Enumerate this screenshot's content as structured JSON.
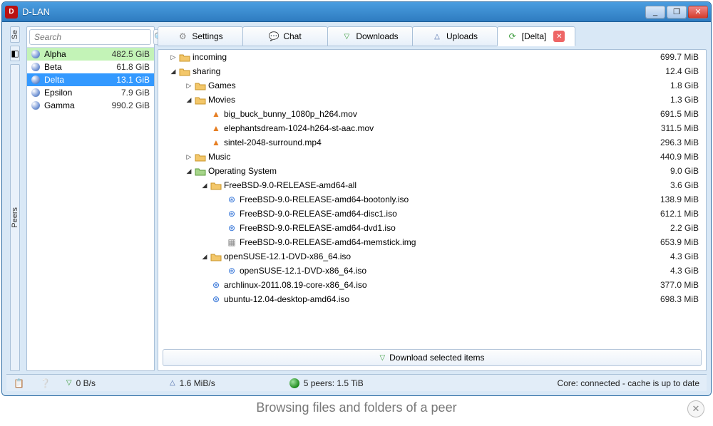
{
  "window": {
    "title": "D-LAN",
    "min": "_",
    "max": "❐",
    "close": "✕"
  },
  "search": {
    "placeholder": "Search"
  },
  "side": {
    "top": "Se",
    "bottom": "Peers"
  },
  "peers": [
    {
      "name": "Alpha",
      "size": "482.5 GiB",
      "cls": "alpha"
    },
    {
      "name": "Beta",
      "size": "61.8 GiB",
      "cls": ""
    },
    {
      "name": "Delta",
      "size": "13.1 GiB",
      "cls": "sel"
    },
    {
      "name": "Epsilon",
      "size": "7.9 GiB",
      "cls": ""
    },
    {
      "name": "Gamma",
      "size": "990.2 GiB",
      "cls": ""
    }
  ],
  "tabs": [
    {
      "label": "Settings",
      "icon": "gear"
    },
    {
      "label": "Chat",
      "icon": "chat"
    },
    {
      "label": "Downloads",
      "icon": "down"
    },
    {
      "label": "Uploads",
      "icon": "up"
    },
    {
      "label": "[Delta]",
      "icon": "refresh",
      "active": true,
      "closable": true
    }
  ],
  "tree": [
    {
      "d": 0,
      "exp": "▷",
      "ico": "folder",
      "name": "incoming",
      "size": "699.7 MiB"
    },
    {
      "d": 0,
      "exp": "◢",
      "ico": "folder",
      "name": "sharing",
      "size": "12.4 GiB"
    },
    {
      "d": 1,
      "exp": "▷",
      "ico": "folder",
      "name": "Games",
      "size": "1.8 GiB"
    },
    {
      "d": 1,
      "exp": "◢",
      "ico": "folder",
      "name": "Movies",
      "size": "1.3 GiB"
    },
    {
      "d": 2,
      "exp": "",
      "ico": "vlc",
      "name": "big_buck_bunny_1080p_h264.mov",
      "size": "691.5 MiB"
    },
    {
      "d": 2,
      "exp": "",
      "ico": "vlc",
      "name": "elephantsdream-1024-h264-st-aac.mov",
      "size": "311.5 MiB"
    },
    {
      "d": 2,
      "exp": "",
      "ico": "vlc",
      "name": "sintel-2048-surround.mp4",
      "size": "296.3 MiB"
    },
    {
      "d": 1,
      "exp": "▷",
      "ico": "folder",
      "name": "Music",
      "size": "440.9 MiB"
    },
    {
      "d": 1,
      "exp": "◢",
      "ico": "folder-green",
      "name": "Operating System",
      "size": "9.0 GiB"
    },
    {
      "d": 2,
      "exp": "◢",
      "ico": "folder",
      "name": "FreeBSD-9.0-RELEASE-amd64-all",
      "size": "3.6 GiB"
    },
    {
      "d": 3,
      "exp": "",
      "ico": "iso",
      "name": "FreeBSD-9.0-RELEASE-amd64-bootonly.iso",
      "size": "138.9 MiB"
    },
    {
      "d": 3,
      "exp": "",
      "ico": "iso",
      "name": "FreeBSD-9.0-RELEASE-amd64-disc1.iso",
      "size": "612.1 MiB"
    },
    {
      "d": 3,
      "exp": "",
      "ico": "iso",
      "name": "FreeBSD-9.0-RELEASE-amd64-dvd1.iso",
      "size": "2.2 GiB"
    },
    {
      "d": 3,
      "exp": "",
      "ico": "img",
      "name": "FreeBSD-9.0-RELEASE-amd64-memstick.img",
      "size": "653.9 MiB"
    },
    {
      "d": 2,
      "exp": "◢",
      "ico": "folder",
      "name": "openSUSE-12.1-DVD-x86_64.iso",
      "size": "4.3 GiB"
    },
    {
      "d": 3,
      "exp": "",
      "ico": "iso",
      "name": "openSUSE-12.1-DVD-x86_64.iso",
      "size": "4.3 GiB"
    },
    {
      "d": 2,
      "exp": "",
      "ico": "iso",
      "name": "archlinux-2011.08.19-core-x86_64.iso",
      "size": "377.0 MiB"
    },
    {
      "d": 2,
      "exp": "",
      "ico": "iso",
      "name": "ubuntu-12.04-desktop-amd64.iso",
      "size": "698.3 MiB"
    }
  ],
  "dlbtn": "Download selected items",
  "status": {
    "down": "0 B/s",
    "up": "1.6 MiB/s",
    "peers": "5 peers: 1.5 TiB",
    "core": "Core: connected - cache is up to date"
  },
  "caption": "Browsing files and folders of a peer"
}
